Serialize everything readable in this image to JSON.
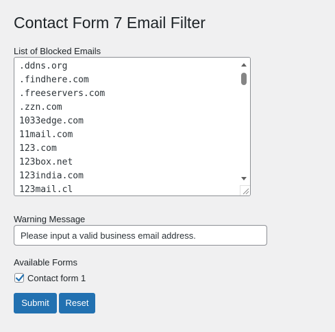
{
  "page": {
    "title": "Contact Form 7 Email Filter"
  },
  "blocked_emails": {
    "label": "List of Blocked Emails",
    "lines": [
      ".ddns.org",
      ".findhere.com",
      ".freeservers.com",
      ".zzn.com",
      "1033edge.com",
      "11mail.com",
      "123.com",
      "123box.net",
      "123india.com",
      "123mail.cl"
    ]
  },
  "warning": {
    "label": "Warning Message",
    "value": "Please input a valid business email address."
  },
  "forms": {
    "label": "Available Forms",
    "items": [
      {
        "label": "Contact form 1",
        "checked": true
      }
    ]
  },
  "actions": {
    "submit_label": "Submit",
    "reset_label": "Reset"
  },
  "colors": {
    "background": "#f0f0f1",
    "primary_button": "#2271b1",
    "checkbox_check": "#2271b1"
  }
}
